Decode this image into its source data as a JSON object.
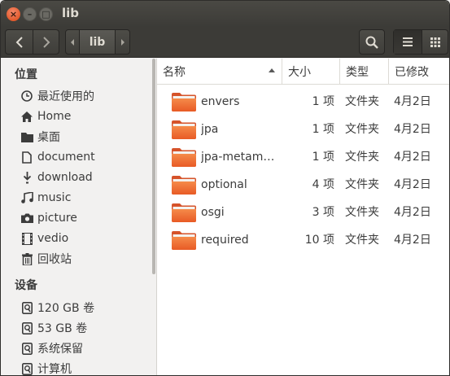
{
  "window": {
    "title": "lib",
    "close_label": "×",
    "minimize_label": "–",
    "maximize_label": "□"
  },
  "toolbar": {
    "back_icon": "chevron-left-icon",
    "forward_icon": "chevron-right-icon",
    "breadcrumb_current": "lib",
    "search_icon": "search-icon",
    "list_view_icon": "list-view-icon",
    "grid_view_icon": "grid-view-icon"
  },
  "sidebar": {
    "places_header": "位置",
    "places": [
      {
        "label": "最近使用的",
        "icon": "clock-icon"
      },
      {
        "label": "Home",
        "icon": "home-icon"
      },
      {
        "label": "桌面",
        "icon": "desktop-folder-icon"
      },
      {
        "label": "document",
        "icon": "document-icon"
      },
      {
        "label": "download",
        "icon": "download-icon"
      },
      {
        "label": "music",
        "icon": "music-icon"
      },
      {
        "label": "picture",
        "icon": "camera-icon"
      },
      {
        "label": "vedio",
        "icon": "film-icon"
      },
      {
        "label": "回收站",
        "icon": "trash-icon"
      }
    ],
    "devices_header": "设备",
    "devices": [
      {
        "label": "120 GB 卷",
        "icon": "drive-icon"
      },
      {
        "label": "53 GB 卷",
        "icon": "drive-icon"
      },
      {
        "label": "系统保留",
        "icon": "drive-icon"
      },
      {
        "label": "计算机",
        "icon": "drive-icon"
      }
    ]
  },
  "columns": {
    "name": "名称",
    "size": "大小",
    "type": "类型",
    "modified": "已修改"
  },
  "files": [
    {
      "name": "envers",
      "size": "1 项",
      "type": "文件夹",
      "modified": "4月2日"
    },
    {
      "name": "jpa",
      "size": "1 项",
      "type": "文件夹",
      "modified": "4月2日"
    },
    {
      "name": "jpa-metam…",
      "size": "1 项",
      "type": "文件夹",
      "modified": "4月2日"
    },
    {
      "name": "optional",
      "size": "4 项",
      "type": "文件夹",
      "modified": "4月2日"
    },
    {
      "name": "osgi",
      "size": "3 项",
      "type": "文件夹",
      "modified": "4月2日"
    },
    {
      "name": "required",
      "size": "10 项",
      "type": "文件夹",
      "modified": "4月2日"
    }
  ],
  "colors": {
    "titlebar": "#3c3b37",
    "close_button": "#e25a2c",
    "folder_orange": "#f06d31",
    "sidebar_bg": "#f2f1f0"
  }
}
